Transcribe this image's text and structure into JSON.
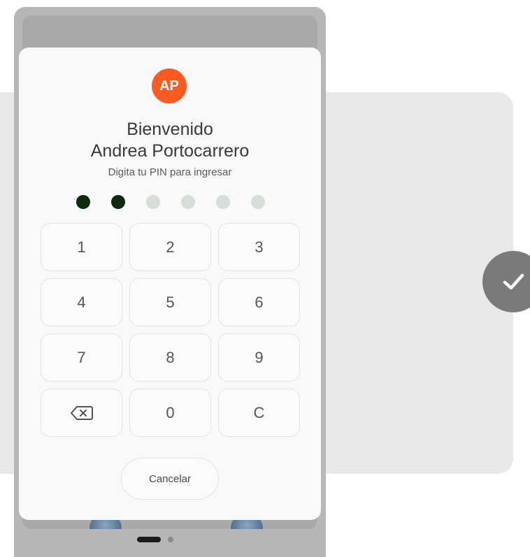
{
  "user": {
    "initials": "AP",
    "avatar_color": "#ff5a1f"
  },
  "login": {
    "welcome": "Bienvenido",
    "name": "Andrea Portocarrero",
    "prompt": "Digita tu PIN para ingresar"
  },
  "pin": {
    "length": 6,
    "entered": 2,
    "filled_color": "#0d2a10",
    "empty_color": "#d7ddd8"
  },
  "keypad": {
    "k1": "1",
    "k2": "2",
    "k3": "3",
    "k4": "4",
    "k5": "5",
    "k6": "6",
    "k7": "7",
    "k8": "8",
    "k9": "9",
    "backspace_icon": "backspace-icon",
    "k0": "0",
    "clear": "C"
  },
  "actions": {
    "cancel_label": "Cancelar",
    "confirm_icon": "checkmark-icon"
  }
}
